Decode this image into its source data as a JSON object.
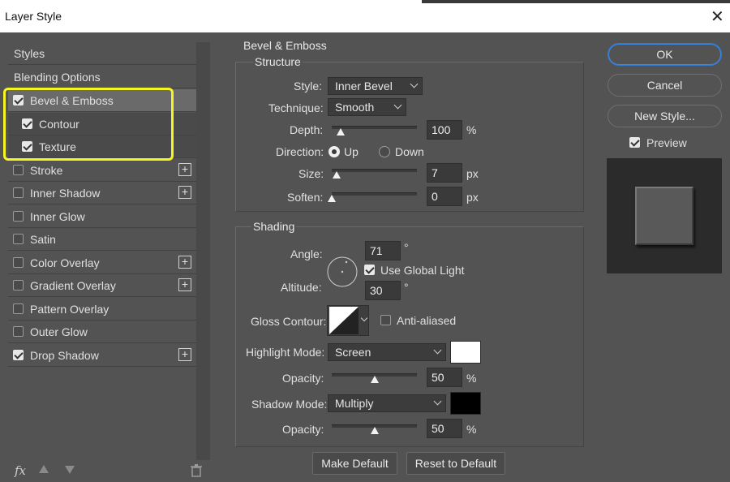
{
  "window": {
    "title": "Layer Style",
    "close_glyph": "✕"
  },
  "left_panel": {
    "styles_label": "Styles",
    "blending_label": "Blending Options",
    "items": [
      {
        "label": "Bevel & Emboss",
        "checked": true,
        "plus": false
      },
      {
        "label": "Contour",
        "checked": true,
        "plus": false
      },
      {
        "label": "Texture",
        "checked": true,
        "plus": false
      },
      {
        "label": "Stroke",
        "checked": false,
        "plus": true
      },
      {
        "label": "Inner Shadow",
        "checked": false,
        "plus": true
      },
      {
        "label": "Inner Glow",
        "checked": false,
        "plus": false
      },
      {
        "label": "Satin",
        "checked": false,
        "plus": false
      },
      {
        "label": "Color Overlay",
        "checked": false,
        "plus": true
      },
      {
        "label": "Gradient Overlay",
        "checked": false,
        "plus": true
      },
      {
        "label": "Pattern Overlay",
        "checked": false,
        "plus": false
      },
      {
        "label": "Outer Glow",
        "checked": false,
        "plus": false
      },
      {
        "label": "Drop Shadow",
        "checked": true,
        "plus": true
      }
    ],
    "fx_label": "fx"
  },
  "bevel": {
    "heading": "Bevel & Emboss",
    "structure_heading": "Structure",
    "style_label": "Style:",
    "style_value": "Inner Bevel",
    "technique_label": "Technique:",
    "technique_value": "Smooth",
    "depth_label": "Depth:",
    "depth_value": "100",
    "depth_unit": "%",
    "depth_level": 0.1,
    "direction_label": "Direction:",
    "direction_up": "Up",
    "direction_down": "Down",
    "size_label": "Size:",
    "size_value": "7",
    "size_unit": "px",
    "size_level": 0.06,
    "soften_label": "Soften:",
    "soften_value": "0",
    "soften_unit": "px",
    "soften_level": 0.0
  },
  "shading": {
    "heading": "Shading",
    "angle_label": "Angle:",
    "angle_value": "71",
    "angle_unit": "°",
    "global_light_label": "Use Global Light",
    "global_light_checked": true,
    "altitude_label": "Altitude:",
    "altitude_value": "30",
    "altitude_unit": "°",
    "gloss_label": "Gloss Contour:",
    "anti_aliased_label": "Anti-aliased",
    "anti_aliased_checked": false,
    "highlight_mode_label": "Highlight Mode:",
    "highlight_mode_value": "Screen",
    "highlight_color": "#ffffff",
    "highlight_opacity_label": "Opacity:",
    "highlight_opacity_value": "50",
    "highlight_opacity_unit": "%",
    "highlight_opacity_level": 0.5,
    "shadow_mode_label": "Shadow Mode:",
    "shadow_mode_value": "Multiply",
    "shadow_color": "#000000",
    "shadow_opacity_label": "Opacity:",
    "shadow_opacity_value": "50",
    "shadow_opacity_unit": "%",
    "shadow_opacity_level": 0.5
  },
  "footer": {
    "make_default": "Make Default",
    "reset_default": "Reset to Default"
  },
  "right_panel": {
    "ok": "OK",
    "cancel": "Cancel",
    "new_style": "New Style...",
    "preview_label": "Preview",
    "preview_checked": true
  },
  "colors": {
    "highlight": "#f5f524",
    "ok_border": "#2f7dd8"
  }
}
